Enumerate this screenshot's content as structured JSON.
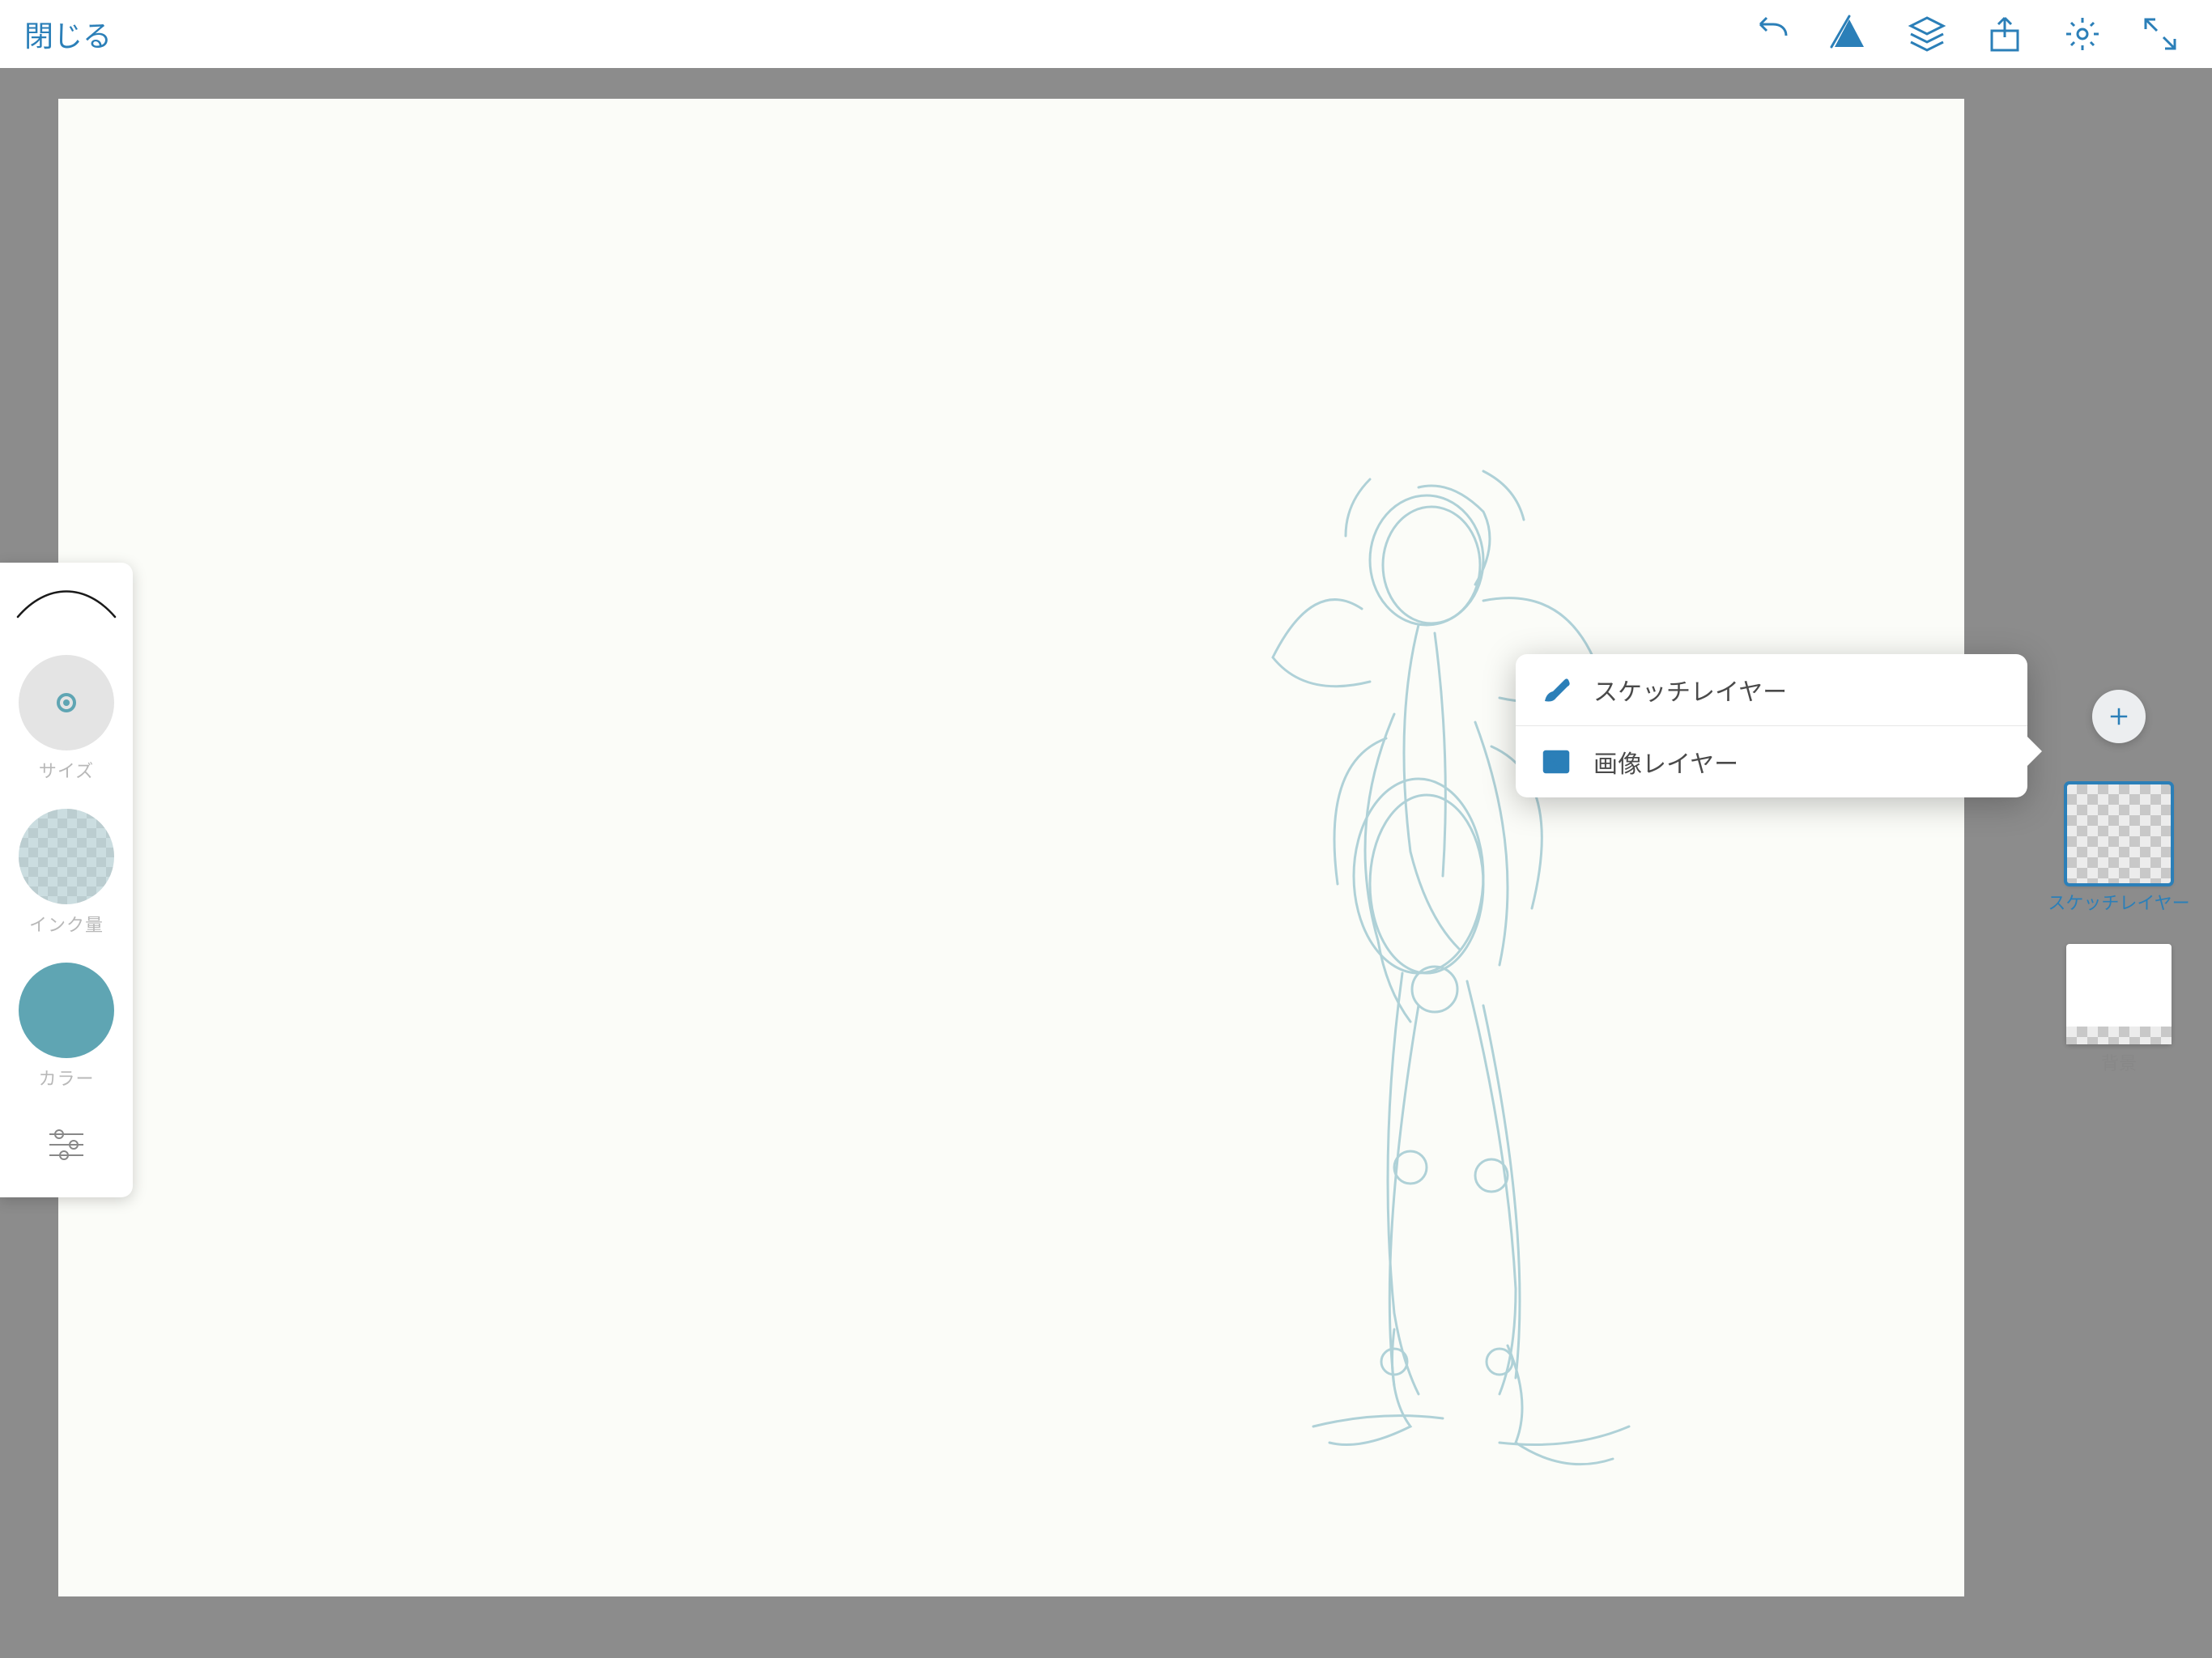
{
  "toolbar": {
    "close_label": "閉じる"
  },
  "left_panel": {
    "size_label": "サイズ",
    "ink_label": "インク量",
    "color_label": "カラー"
  },
  "popover": {
    "sketch_layer_label": "スケッチレイヤー",
    "image_layer_label": "画像レイヤー"
  },
  "right_panel": {
    "layer1_label": "スケッチレイヤー",
    "layer2_label": "背景"
  }
}
